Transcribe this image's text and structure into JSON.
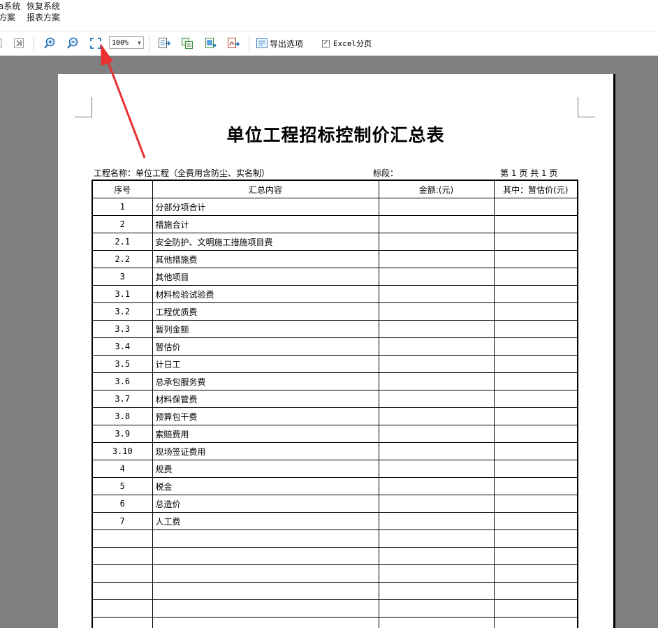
{
  "ribbon": {
    "buttons": [
      {
        "line1": "a系统",
        "line2": "方案"
      },
      {
        "line1": "恢复系统",
        "line2": "报表方案"
      }
    ]
  },
  "toolbar": {
    "zoom": "100%",
    "export_options_label": "导出选项",
    "excel_paging_label": "Excel分页",
    "excel_paging_checked": "✓"
  },
  "report": {
    "title": "单位工程招标控制价汇总表",
    "project_name": "工程名称：单位工程（全费用含防尘、实名制）",
    "section_label": "标段：",
    "page_info": "第 1 页  共 1 页",
    "headers": [
      "序号",
      "汇总内容",
      "金额:(元)",
      "其中：暂估价(元)"
    ],
    "rows": [
      {
        "no": "1",
        "name": "分部分项合计"
      },
      {
        "no": "2",
        "name": "措施合计"
      },
      {
        "no": "2.1",
        "name": "安全防护、文明施工措施项目费"
      },
      {
        "no": "2.2",
        "name": "其他措施费"
      },
      {
        "no": "3",
        "name": "其他项目"
      },
      {
        "no": "3.1",
        "name": "材料检验试验费"
      },
      {
        "no": "3.2",
        "name": "工程优质费"
      },
      {
        "no": "3.3",
        "name": "暂列金额"
      },
      {
        "no": "3.4",
        "name": "暂估价"
      },
      {
        "no": "3.5",
        "name": "计日工"
      },
      {
        "no": "3.6",
        "name": "总承包服务费"
      },
      {
        "no": "3.7",
        "name": "材料保管费"
      },
      {
        "no": "3.8",
        "name": "预算包干费"
      },
      {
        "no": "3.9",
        "name": "索赔费用"
      },
      {
        "no": "3.10",
        "name": "现场签证费用"
      },
      {
        "no": "4",
        "name": "规费"
      },
      {
        "no": "5",
        "name": "税金"
      },
      {
        "no": "6",
        "name": "总造价"
      },
      {
        "no": "7",
        "name": "人工费"
      },
      {
        "no": "",
        "name": ""
      },
      {
        "no": "",
        "name": ""
      },
      {
        "no": "",
        "name": ""
      },
      {
        "no": "",
        "name": ""
      },
      {
        "no": "",
        "name": ""
      },
      {
        "no": "",
        "name": ""
      }
    ]
  },
  "colors": {
    "preview_bg": "#808080",
    "annotation_arrow": "#e8312f"
  }
}
